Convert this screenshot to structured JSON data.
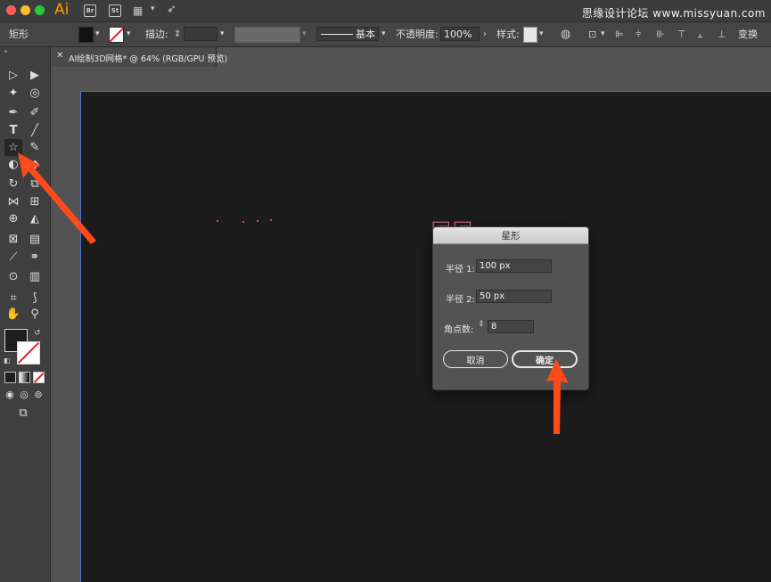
{
  "app": {
    "logo": "Ai",
    "bridge_label": "Br",
    "stock_label": "St",
    "watermark": "思缘设计论坛 www.missyuan.com"
  },
  "controlbar": {
    "object_label": "矩形",
    "stroke_label": "描边:",
    "stroke_profile_label": "基本",
    "opacity_label": "不透明度:",
    "opacity_value": "100%",
    "style_label": "样式:",
    "transform_label": "变换"
  },
  "document": {
    "tab_title": "AI绘制3D网格* @ 64% (RGB/GPU 预览)"
  },
  "canvas": {
    "art_text": "EE"
  },
  "dialog": {
    "title": "星形",
    "radius1_label": "半径 1:",
    "radius1_value": "100 px",
    "radius2_label": "半径 2:",
    "radius2_value": "50 px",
    "points_label": "角点数:",
    "points_value": "8",
    "cancel_label": "取消",
    "ok_label": "确定"
  },
  "colors": {
    "accent_arrow": "#ff4a1c",
    "artboard_border": "#4a6ed6",
    "logo": "#ff9a00"
  }
}
